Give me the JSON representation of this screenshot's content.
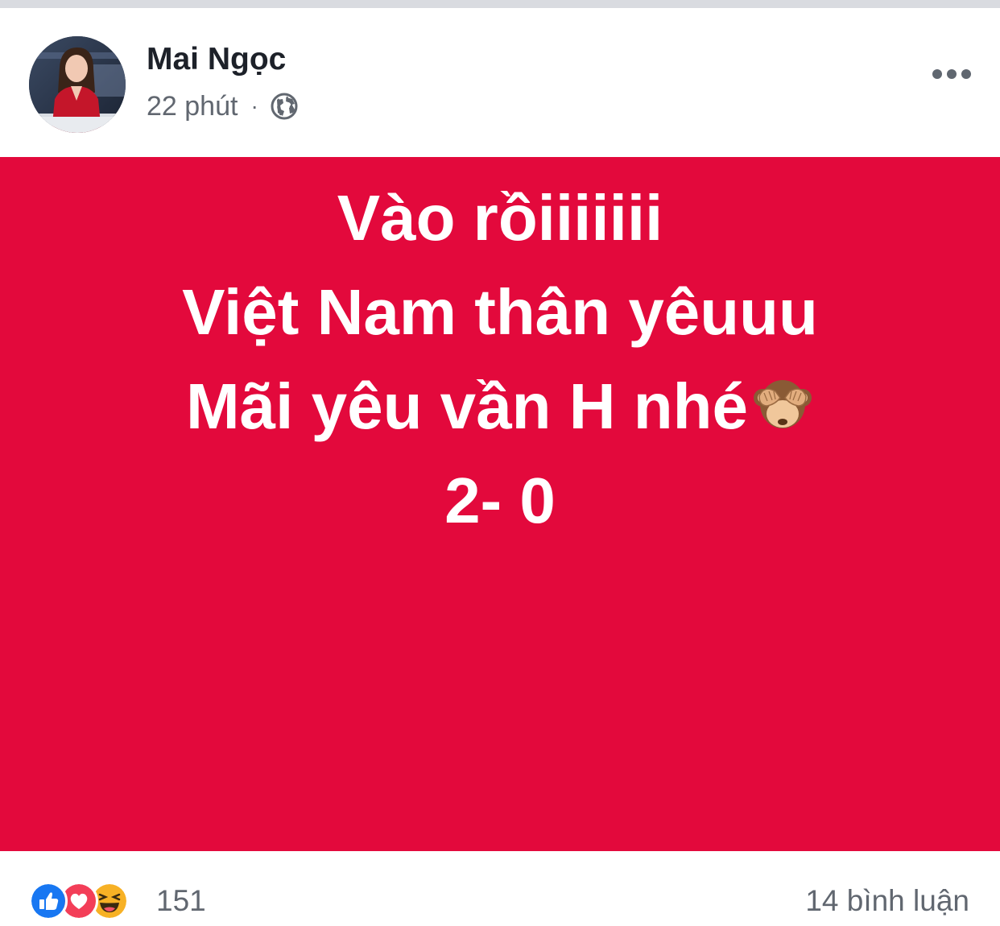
{
  "post": {
    "author": "Mai Ngọc",
    "time": "22 phút",
    "separator": "·",
    "privacy_icon": "globe-icon",
    "more_icon": "more-options-icon",
    "background_color": "#e3093c",
    "text_color": "#ffffff",
    "lines": [
      "Vào rồiiiiiii",
      "Việt Nam thân yêuuu",
      "Mãi yêu vần H nhé",
      "2- 0"
    ],
    "emoji": "see-no-evil-monkey-icon"
  },
  "footer": {
    "reaction_icons": [
      "like-icon",
      "love-icon",
      "haha-icon"
    ],
    "reaction_count": "151",
    "comments": "14 bình luận"
  },
  "colors": {
    "like": "#1877f2",
    "love": "#f33e58",
    "haha": "#f7b125",
    "meta_text": "#616770",
    "name_text": "#1d2129"
  }
}
